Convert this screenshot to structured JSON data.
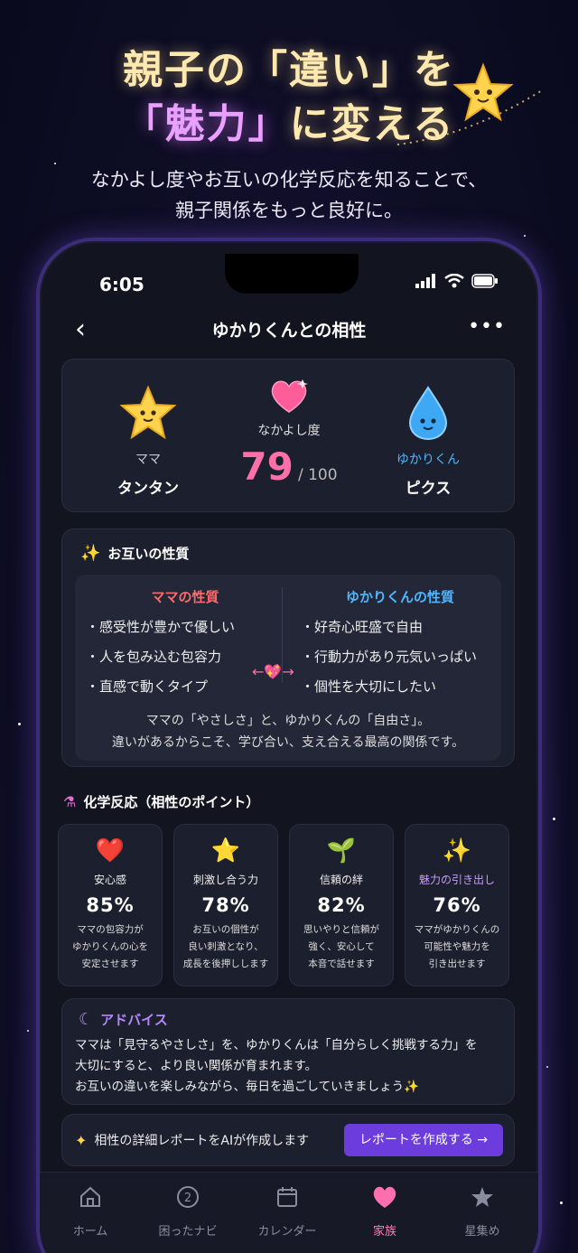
{
  "hero": {
    "line1": "親子の「違い」を",
    "line2_pink": "「魅力」",
    "line2_rest": "に変える",
    "sub1": "なかよし度やお互いの化学反応を知ることで、",
    "sub2": "親子関係をもっと良好に。"
  },
  "status": {
    "time": "6:05"
  },
  "nav": {
    "back": "‹",
    "title": "ゆかりくんとの相性",
    "more": "•••"
  },
  "score": {
    "left_role": "ママ",
    "left_name": "タンタン",
    "left_icon": "star-character-icon",
    "label": "なかよし度",
    "value": "79",
    "max": "/ 100",
    "right_role": "ゆかりくん",
    "right_name": "ピクス",
    "right_icon": "water-drop-character-icon"
  },
  "traits": {
    "title": "お互いの性質",
    "mama_title": "ママの性質",
    "mama_items": [
      "・感受性が豊かで優しい",
      "・人を包み込む包容力",
      "・直感で動くタイプ"
    ],
    "yukari_title": "ゆかりくんの性質",
    "yukari_items": [
      "・好奇心旺盛で自由",
      "・行動力があり元気いっぱい",
      "・個性を大切にしたい"
    ],
    "arrow": "←💖→",
    "note1": "ママの「やさしさ」と、ゆかりくんの「自由さ」。",
    "note2": "違いがあるからこそ、学び合い、支え合える最高の関係です。"
  },
  "chem": {
    "title": "化学反応（相性のポイント）",
    "items": [
      {
        "icon": "❤️",
        "label": "安心感",
        "pct": "85%",
        "d1": "ママの包容力が",
        "d2": "ゆかりくんの心を",
        "d3": "安定させます",
        "color": "#eeeeee"
      },
      {
        "icon": "⭐",
        "label": "刺激し合う力",
        "pct": "78%",
        "d1": "お互いの個性が",
        "d2": "良い刺激となり、",
        "d3": "成長を後押しします",
        "color": "#eeeeee"
      },
      {
        "icon": "🌱",
        "label": "信頼の絆",
        "pct": "82%",
        "d1": "思いやりと信頼が",
        "d2": "強く、安心して",
        "d3": "本音で話せます",
        "color": "#eeeeee"
      },
      {
        "icon": "✨",
        "label": "魅力の引き出し",
        "pct": "76%",
        "d1": "ママがゆかりくんの",
        "d2": "可能性や魅力を",
        "d3": "引き出せます",
        "color": "#c79cff"
      }
    ]
  },
  "advice": {
    "title": "アドバイス",
    "l1": "ママは「見守るやさしさ」を、ゆかりくんは「自分らしく挑戦する力」を",
    "l2": "大切にすると、より良い関係が育まれます。",
    "l3": "お互いの違いを楽しみながら、毎日を過ごしていきましょう✨"
  },
  "report": {
    "text": "相性の詳細レポートをAIが作成します",
    "button": "レポートを作成する →"
  },
  "tabs": [
    {
      "label": "ホーム",
      "icon": "home-icon"
    },
    {
      "label": "困ったナビ",
      "icon": "help-navi-icon"
    },
    {
      "label": "カレンダー",
      "icon": "calendar-icon"
    },
    {
      "label": "家族",
      "icon": "heart-icon"
    },
    {
      "label": "星集め",
      "icon": "star-icon"
    }
  ]
}
